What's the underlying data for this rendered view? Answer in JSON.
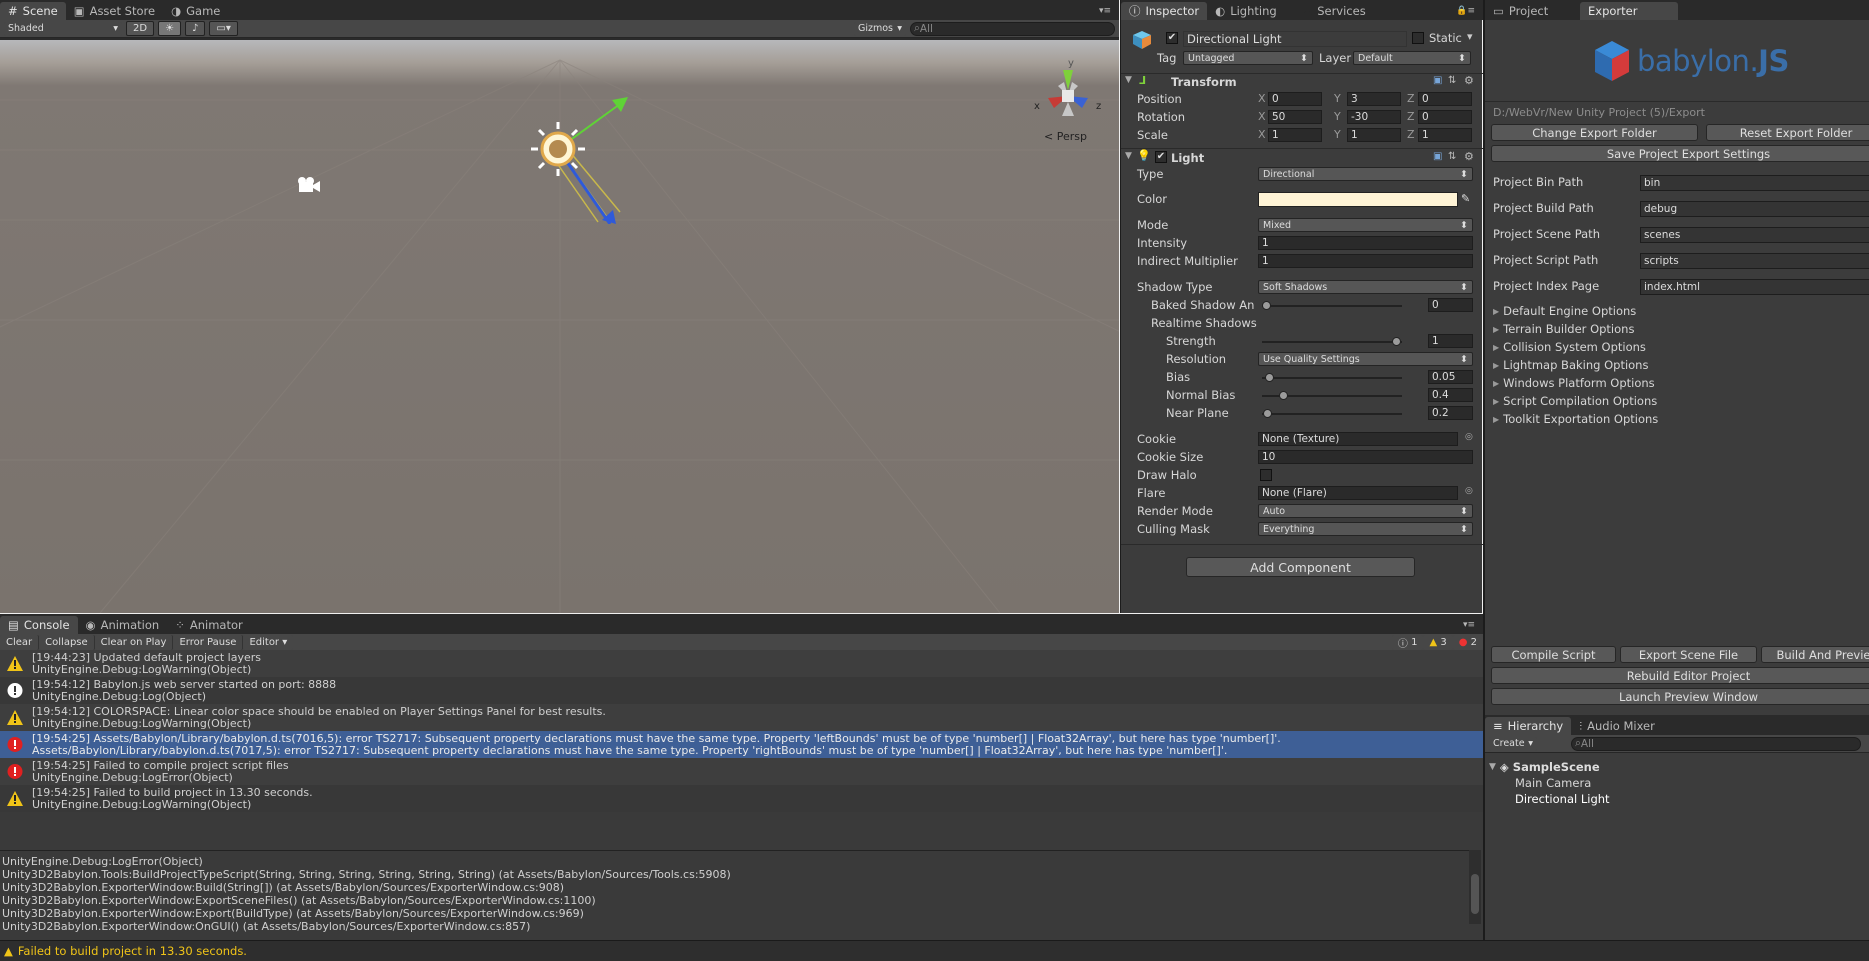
{
  "scene_tabs": [
    {
      "label": "Scene",
      "icon": "grid-icon"
    },
    {
      "label": "Asset Store",
      "icon": "store-icon"
    },
    {
      "label": "Game",
      "icon": "gamepad-icon"
    }
  ],
  "scene_toolbar": {
    "shading": "Shaded",
    "mode_2d": "2D",
    "gizmos": "Gizmos",
    "search_placeholder": "All"
  },
  "viewport": {
    "persp_label": "Persp",
    "axis_y": "y",
    "axis_x": "x",
    "axis_z": "z"
  },
  "inspector_tabs": [
    {
      "label": "Inspector"
    },
    {
      "label": "Lighting"
    },
    {
      "label": "Services"
    }
  ],
  "object": {
    "name": "Directional Light",
    "static_label": "Static",
    "tag_label": "Tag",
    "tag_value": "Untagged",
    "layer_label": "Layer",
    "layer_value": "Default"
  },
  "transform": {
    "title": "Transform",
    "rows": [
      {
        "label": "Position",
        "x": "0",
        "y": "3",
        "z": "0"
      },
      {
        "label": "Rotation",
        "x": "50",
        "y": "-30",
        "z": "0"
      },
      {
        "label": "Scale",
        "x": "1",
        "y": "1",
        "z": "1"
      }
    ]
  },
  "light": {
    "title": "Light",
    "type_label": "Type",
    "type_value": "Directional",
    "color_label": "Color",
    "color_value": "#fff4d6",
    "mode_label": "Mode",
    "mode_value": "Mixed",
    "intensity_label": "Intensity",
    "intensity_value": "1",
    "indirect_label": "Indirect Multiplier",
    "indirect_value": "1",
    "shadow_type_label": "Shadow Type",
    "shadow_type_value": "Soft Shadows",
    "baked_label": "Baked Shadow An",
    "baked_value": "0",
    "baked_level": 0,
    "realtime_label": "Realtime Shadows",
    "strength_label": "Strength",
    "strength_value": "1",
    "strength_level": 1,
    "resolution_label": "Resolution",
    "resolution_value": "Use Quality Settings",
    "bias_label": "Bias",
    "bias_value": "0.05",
    "bias_level": 0.025,
    "normal_bias_label": "Normal Bias",
    "normal_bias_value": "0.4",
    "normal_bias_level": 0.13,
    "near_plane_label": "Near Plane",
    "near_plane_value": "0.2",
    "near_plane_level": 0.01,
    "cookie_label": "Cookie",
    "cookie_value": "None (Texture)",
    "cookie_size_label": "Cookie Size",
    "cookie_size_value": "10",
    "draw_halo_label": "Draw Halo",
    "flare_label": "Flare",
    "flare_value": "None (Flare)",
    "render_mode_label": "Render Mode",
    "render_mode_value": "Auto",
    "culling_label": "Culling Mask",
    "culling_value": "Everything"
  },
  "add_component": "Add Component",
  "right_tabs": [
    {
      "label": "Project"
    },
    {
      "label": "Exporter"
    }
  ],
  "exporter": {
    "logo_text": "babylon",
    "logo_suffix": "JS",
    "export_path": "D:/WebVr/New Unity Project (5)/Export",
    "change_folder": "Change Export Folder",
    "reset_folder": "Reset Export Folder",
    "save_settings": "Save Project Export Settings",
    "paths": [
      {
        "label": "Project Bin Path",
        "value": "bin"
      },
      {
        "label": "Project Build Path",
        "value": "debug"
      },
      {
        "label": "Project Scene Path",
        "value": "scenes"
      },
      {
        "label": "Project Script Path",
        "value": "scripts"
      },
      {
        "label": "Project Index Page",
        "value": "index.html"
      }
    ],
    "options": [
      "Default Engine Options",
      "Terrain Builder Options",
      "Collision System Options",
      "Lightmap Baking Options",
      "Windows Platform Options",
      "Script Compilation Options",
      "Toolkit Exportation Options"
    ],
    "compile": "Compile Script",
    "export_scene": "Export Scene File",
    "build_preview": "Build And Previe",
    "rebuild": "Rebuild Editor Project",
    "launch": "Launch Preview Window"
  },
  "hierarchy_tabs": [
    {
      "label": "Hierarchy"
    },
    {
      "label": "Audio Mixer"
    }
  ],
  "hierarchy": {
    "create": "Create",
    "search_placeholder": "All",
    "scene": "SampleScene",
    "items": [
      "Main Camera",
      "Directional Light"
    ]
  },
  "console_tabs": [
    {
      "label": "Console"
    },
    {
      "label": "Animation"
    },
    {
      "label": "Animator"
    }
  ],
  "console_toolbar": {
    "clear": "Clear",
    "collapse": "Collapse",
    "clear_on_play": "Clear on Play",
    "error_pause": "Error Pause",
    "editor": "Editor",
    "count_log": "1",
    "count_warn": "3",
    "count_error": "2"
  },
  "console_entries": [
    {
      "kind": "warning",
      "line1": "[19:44:23] Updated default project layers",
      "line2": "UnityEngine.Debug:LogWarning(Object)"
    },
    {
      "kind": "info",
      "line1": "[19:54:12] Babylon.js web server started on port: 8888",
      "line2": "UnityEngine.Debug:Log(Object)"
    },
    {
      "kind": "warning",
      "line1": "[19:54:12] COLORSPACE: Linear color space should be enabled on Player Settings Panel for best results.",
      "line2": "UnityEngine.Debug:LogWarning(Object)"
    },
    {
      "kind": "error",
      "line1": "[19:54:25] Assets/Babylon/Library/babylon.d.ts(7016,5): error TS2717: Subsequent property declarations must have the same type.  Property 'leftBounds' must be of type 'number[] | Float32Array', but here has type 'number[]'.",
      "line2": "Assets/Babylon/Library/babylon.d.ts(7017,5): error TS2717: Subsequent property declarations must have the same type.  Property 'rightBounds' must be of type 'number[] | Float32Array', but here has type 'number[]'."
    },
    {
      "kind": "error",
      "line1": "[19:54:25] Failed to compile project script files",
      "line2": "UnityEngine.Debug:LogError(Object)"
    },
    {
      "kind": "warning",
      "line1": "[19:54:25] Failed to build project in 13.30 seconds.",
      "line2": "UnityEngine.Debug:LogWarning(Object)"
    }
  ],
  "stacktrace": [
    "UnityEngine.Debug:LogError(Object)",
    "Unity3D2Babylon.Tools:BuildProjectTypeScript(String, String, String, String, String, String) (at Assets/Babylon/Sources/Tools.cs:5908)",
    "Unity3D2Babylon.ExporterWindow:Build(String[]) (at Assets/Babylon/Sources/ExporterWindow.cs:908)",
    "Unity3D2Babylon.ExporterWindow:ExportSceneFiles() (at Assets/Babylon/Sources/ExporterWindow.cs:1100)",
    "Unity3D2Babylon.ExporterWindow:Export(BuildType) (at Assets/Babylon/Sources/ExporterWindow.cs:969)",
    "Unity3D2Babylon.ExporterWindow:OnGUI() (at Assets/Babylon/Sources/ExporterWindow.cs:857)"
  ],
  "status": "Failed to build project in 13.30 seconds."
}
